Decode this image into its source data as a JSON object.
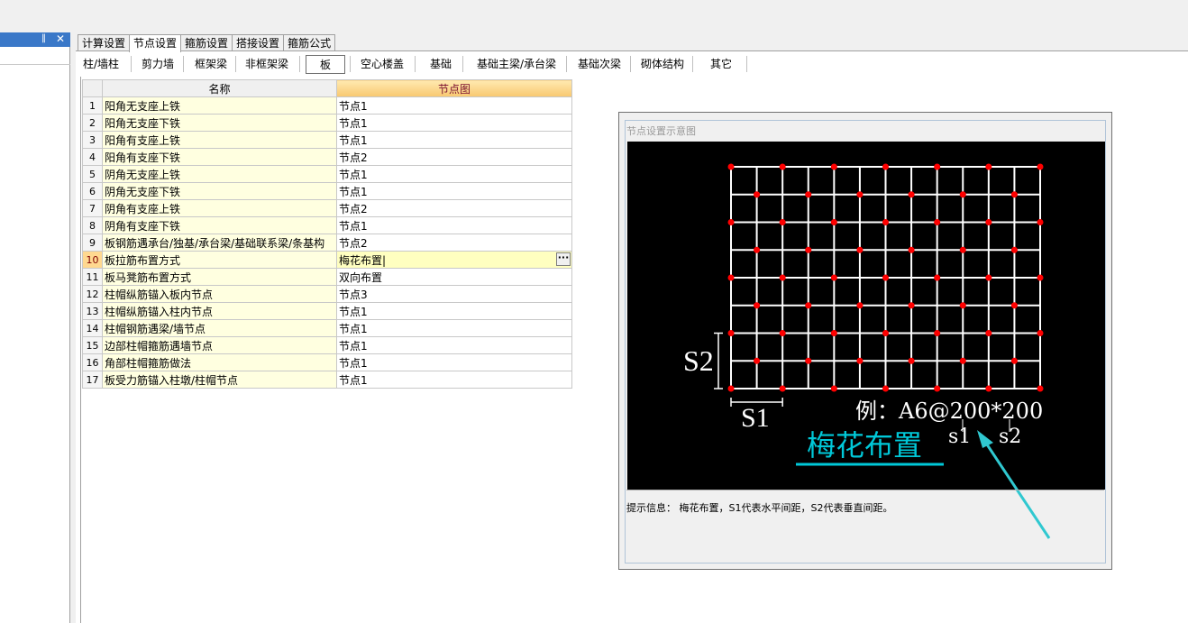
{
  "left_panel": {
    "pin_icon": "pin-icon",
    "close_icon": "close-icon"
  },
  "tabs": [
    {
      "label": "计算设置",
      "active": false
    },
    {
      "label": "节点设置",
      "active": true
    },
    {
      "label": "箍筋设置",
      "active": false
    },
    {
      "label": "搭接设置",
      "active": false
    },
    {
      "label": "箍筋公式",
      "active": false
    }
  ],
  "subtabs": [
    {
      "label": "柱/墙柱"
    },
    {
      "label": "剪力墙"
    },
    {
      "label": "框架梁"
    },
    {
      "label": "非框架梁"
    },
    {
      "label": "板",
      "active": true
    },
    {
      "label": "空心楼盖"
    },
    {
      "label": "基础"
    },
    {
      "label": "基础主梁/承台梁"
    },
    {
      "label": "基础次梁"
    },
    {
      "label": "砌体结构"
    },
    {
      "label": "其它"
    }
  ],
  "table": {
    "headers": {
      "name": "名称",
      "value": "节点图"
    },
    "rows": [
      {
        "num": "1",
        "name": "阳角无支座上铁",
        "value": "节点1"
      },
      {
        "num": "2",
        "name": "阳角无支座下铁",
        "value": "节点1"
      },
      {
        "num": "3",
        "name": "阳角有支座上铁",
        "value": "节点1"
      },
      {
        "num": "4",
        "name": "阳角有支座下铁",
        "value": "节点2"
      },
      {
        "num": "5",
        "name": "阴角无支座上铁",
        "value": "节点1"
      },
      {
        "num": "6",
        "name": "阴角无支座下铁",
        "value": "节点1"
      },
      {
        "num": "7",
        "name": "阴角有支座上铁",
        "value": "节点2"
      },
      {
        "num": "8",
        "name": "阴角有支座下铁",
        "value": "节点1"
      },
      {
        "num": "9",
        "name": "板钢筋遇承台/独基/承台梁/基础联系梁/条基构",
        "value": "节点2"
      },
      {
        "num": "10",
        "name": "板拉筋布置方式",
        "value": "梅花布置|",
        "selected": true
      },
      {
        "num": "11",
        "name": "板马凳筋布置方式",
        "value": "双向布置"
      },
      {
        "num": "12",
        "name": "柱帽纵筋锚入板内节点",
        "value": "节点3"
      },
      {
        "num": "13",
        "name": "柱帽纵筋锚入柱内节点",
        "value": "节点1"
      },
      {
        "num": "14",
        "name": "柱帽钢筋遇梁/墙节点",
        "value": "节点1"
      },
      {
        "num": "15",
        "name": "边部柱帽箍筋遇墙节点",
        "value": "节点1"
      },
      {
        "num": "16",
        "name": "角部柱帽箍筋做法",
        "value": "节点1"
      },
      {
        "num": "17",
        "name": "板受力筋锚入柱墩/柱帽节点",
        "value": "节点1"
      }
    ]
  },
  "diagram": {
    "title": "节点设置示意图",
    "s2_label": "S2",
    "s1_label": "S1",
    "example": "例：A6@200*200",
    "sub_s1": "s1",
    "sub_s2": "s2",
    "caption": "梅花布置",
    "hint": "提示信息： 梅花布置，S1代表水平间距，S2代表垂直间距。",
    "colors": {
      "grid": "#ffffff",
      "dot": "#ff0000",
      "caption": "#00c8d8",
      "arrow": "#30c8d0"
    }
  }
}
